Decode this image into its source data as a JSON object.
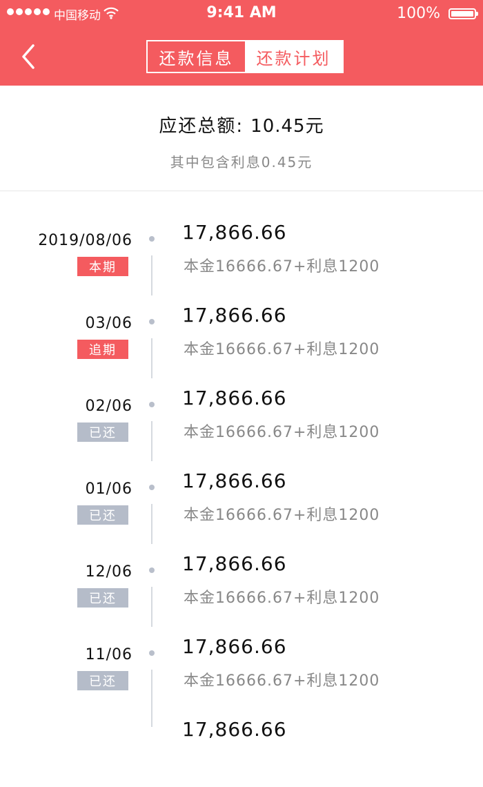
{
  "status_bar": {
    "carrier": "中国移动",
    "time": "9:41 AM",
    "battery": "100%"
  },
  "nav": {
    "tabs": [
      {
        "label": "还款信息",
        "active": true
      },
      {
        "label": "还款计划",
        "active": false
      }
    ]
  },
  "summary": {
    "total_label": "应还总额:",
    "total_value": "10.45元",
    "interest_note": "其中包含利息0.45元"
  },
  "schedule": [
    {
      "date": "2019/08/06",
      "amount": "17,866.66",
      "detail": "本金16666.67+利息1200",
      "status": "本期",
      "status_color": "#f45b5f"
    },
    {
      "date": "03/06",
      "amount": "17,866.66",
      "detail": "本金16666.67+利息1200",
      "status": "追期",
      "status_color": "#f45b5f"
    },
    {
      "date": "02/06",
      "amount": "17,866.66",
      "detail": "本金16666.67+利息1200",
      "status": "已还",
      "status_color": "#b5bcc9"
    },
    {
      "date": "01/06",
      "amount": "17,866.66",
      "detail": "本金16666.67+利息1200",
      "status": "已还",
      "status_color": "#b5bcc9"
    },
    {
      "date": "12/06",
      "amount": "17,866.66",
      "detail": "本金16666.67+利息1200",
      "status": "已还",
      "status_color": "#b5bcc9"
    },
    {
      "date": "11/06",
      "amount": "17,866.66",
      "detail": "本金16666.67+利息1200",
      "status": "已还",
      "status_color": "#b5bcc9"
    },
    {
      "date": "",
      "amount": "17,866.66",
      "detail": "",
      "status": "",
      "status_color": "#b5bcc9"
    }
  ],
  "colors": {
    "accent": "#f45b5f",
    "paid": "#b5bcc9"
  }
}
